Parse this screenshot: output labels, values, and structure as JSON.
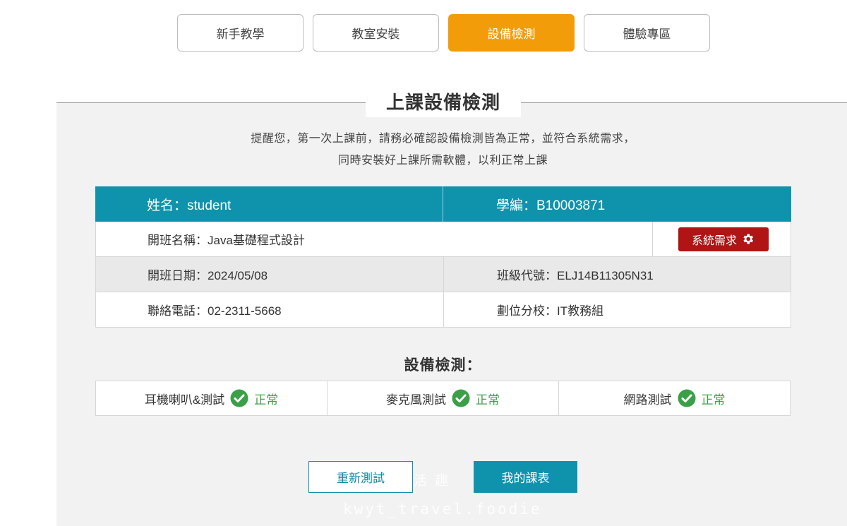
{
  "tabs": [
    {
      "label": "新手教學"
    },
    {
      "label": "教室安裝"
    },
    {
      "label": "設備檢測"
    },
    {
      "label": "體驗專區"
    }
  ],
  "page": {
    "title": "上課設備檢測",
    "notice_line1": "提醒您，第一次上課前，請務必確認設備檢測皆為正常，並符合系統需求，",
    "notice_line2": "同時安裝好上課所需軟體，以利正常上課"
  },
  "info": {
    "name": "姓名：student",
    "student_id": "學編：B10003871",
    "class_name": "開班名稱：Java基礎程式設計",
    "system_requirements_button": "系統需求",
    "start_date": "開班日期：2024/05/08",
    "class_code": "班級代號：ELJ14B11305N31",
    "phone": "聯絡電話：02-2311-5668",
    "branch": "劃位分校：IT教務組"
  },
  "device_check": {
    "title": "設備檢測：",
    "items": [
      {
        "label": "耳機喇叭&測試",
        "status": "正常"
      },
      {
        "label": "麥克風測試",
        "status": "正常"
      },
      {
        "label": "網路測試",
        "status": "正常"
      }
    ]
  },
  "buttons": {
    "retest": "重新測試",
    "my_schedule": "我的課表"
  },
  "watermark": {
    "text1": "活 趣",
    "text2": "kwyt_travel.foodie"
  },
  "colors": {
    "active_tab": "#f29c09",
    "teal": "#0f93ad",
    "danger": "#b01414",
    "ok_green": "#3aa047"
  },
  "icons": {
    "gear": "gear-icon",
    "check": "check-circle-icon"
  }
}
